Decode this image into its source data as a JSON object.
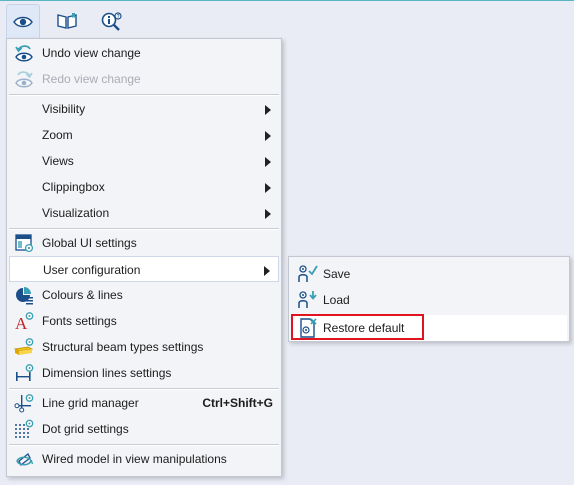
{
  "toolbar": {
    "buttons": [
      {
        "icon": "eye-icon",
        "active": true
      },
      {
        "icon": "book-icon",
        "active": false
      },
      {
        "icon": "info-search-icon",
        "active": false
      }
    ]
  },
  "menu": {
    "items": [
      {
        "label": "Undo view change",
        "icon": "undo-view-icon",
        "enabled": true
      },
      {
        "label": "Redo view change",
        "icon": "redo-view-icon",
        "enabled": false
      },
      {
        "label": "Visibility",
        "submenu": true
      },
      {
        "label": "Zoom",
        "submenu": true
      },
      {
        "label": "Views",
        "submenu": true
      },
      {
        "label": "Clippingbox",
        "submenu": true
      },
      {
        "label": "Visualization",
        "submenu": true
      },
      {
        "label": "Global UI settings",
        "icon": "window-settings-icon"
      },
      {
        "label": "User configuration",
        "submenu": true,
        "hovered": true
      },
      {
        "label": "Colours & lines",
        "icon": "colours-lines-icon"
      },
      {
        "label": "Fonts settings",
        "icon": "font-settings-icon"
      },
      {
        "label": "Structural beam types settings",
        "icon": "beam-settings-icon"
      },
      {
        "label": "Dimension lines settings",
        "icon": "dimension-lines-icon"
      },
      {
        "label": "Line grid manager",
        "icon": "line-grid-icon",
        "shortcut": "Ctrl+Shift+G"
      },
      {
        "label": "Dot grid settings",
        "icon": "dot-grid-icon"
      },
      {
        "label": "Wired model in view manipulations",
        "icon": "wired-model-icon"
      }
    ]
  },
  "submenu": {
    "items": [
      {
        "label": "Save",
        "icon": "user-save-icon"
      },
      {
        "label": "Load",
        "icon": "user-load-icon"
      },
      {
        "label": "Restore default",
        "icon": "restore-default-icon",
        "highlighted": true
      }
    ]
  },
  "colors": {
    "accent": "#3a9fb4",
    "highlight_border": "#e0141e",
    "background": "#e9ebf5",
    "menu_background": "#f3f4f7"
  }
}
